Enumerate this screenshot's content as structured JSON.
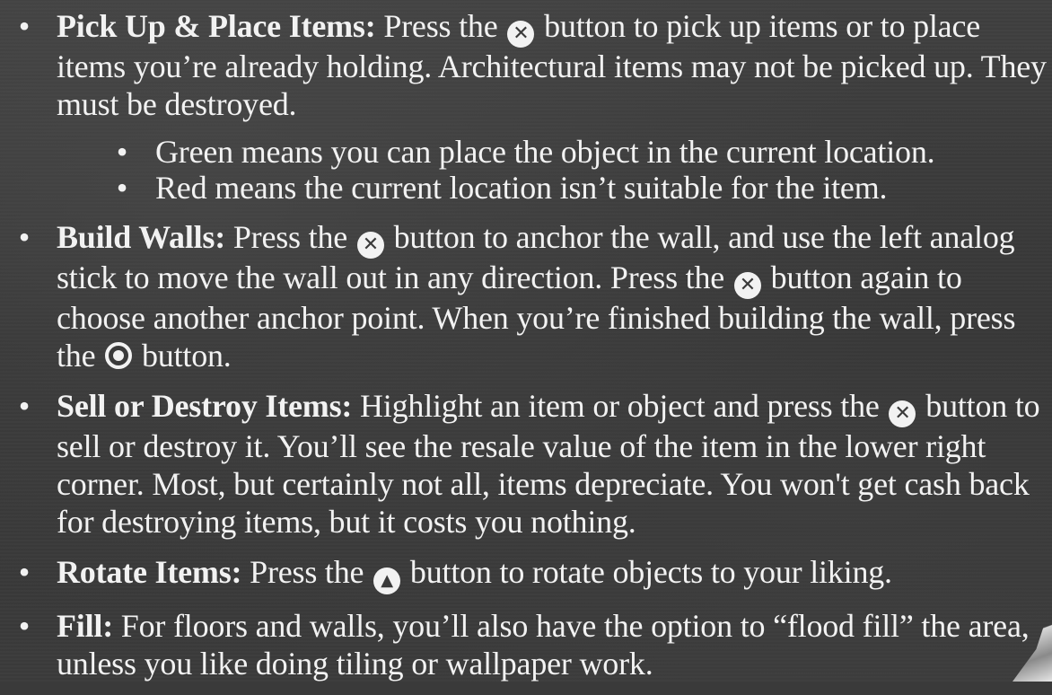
{
  "items": [
    {
      "label": "Pick Up & Place Items:",
      "before": " Press the ",
      "icon": "cross-button-icon",
      "after": " button to pick up items or to place items you’re already holding. Architectural items may not be picked up. They must be destroyed.",
      "subitems": [
        "Green means you can place the object in the current location.",
        "Red means the current location isn’t suitable for the item."
      ]
    },
    {
      "label": "Build Walls:",
      "before": " Press the ",
      "icon": "cross-button-icon",
      "middle": " button to anchor the wall, and use the left analog stick  to move the wall out in any direction. Press the ",
      "icon2": "cross-button-icon",
      "middle2": " button again to choose another anchor point. When you’re finished building the wall, press the ",
      "icon3": "circle-button-icon",
      "after": " button."
    },
    {
      "label": "Sell or Destroy Items:",
      "before": " Highlight an item or object and press the ",
      "icon": "cross-button-icon",
      "after": " button to sell or destroy it. You’ll see the resale value of the item in the lower right corner. Most, but certainly not all, items depreciate. You won't get cash back for destroying items, but it costs you nothing."
    },
    {
      "label": "Rotate Items:",
      "before": " Press the ",
      "icon": "triangle-button-icon",
      "after": " button to rotate objects to your liking."
    },
    {
      "label": "Fill:",
      "text": " For floors and walls, you’ll also have the option to “flood fill” the area, unless you like doing tiling or wallpaper work."
    }
  ],
  "colors": {
    "background": "#3a3a3a",
    "text": "#f2f2f2"
  }
}
